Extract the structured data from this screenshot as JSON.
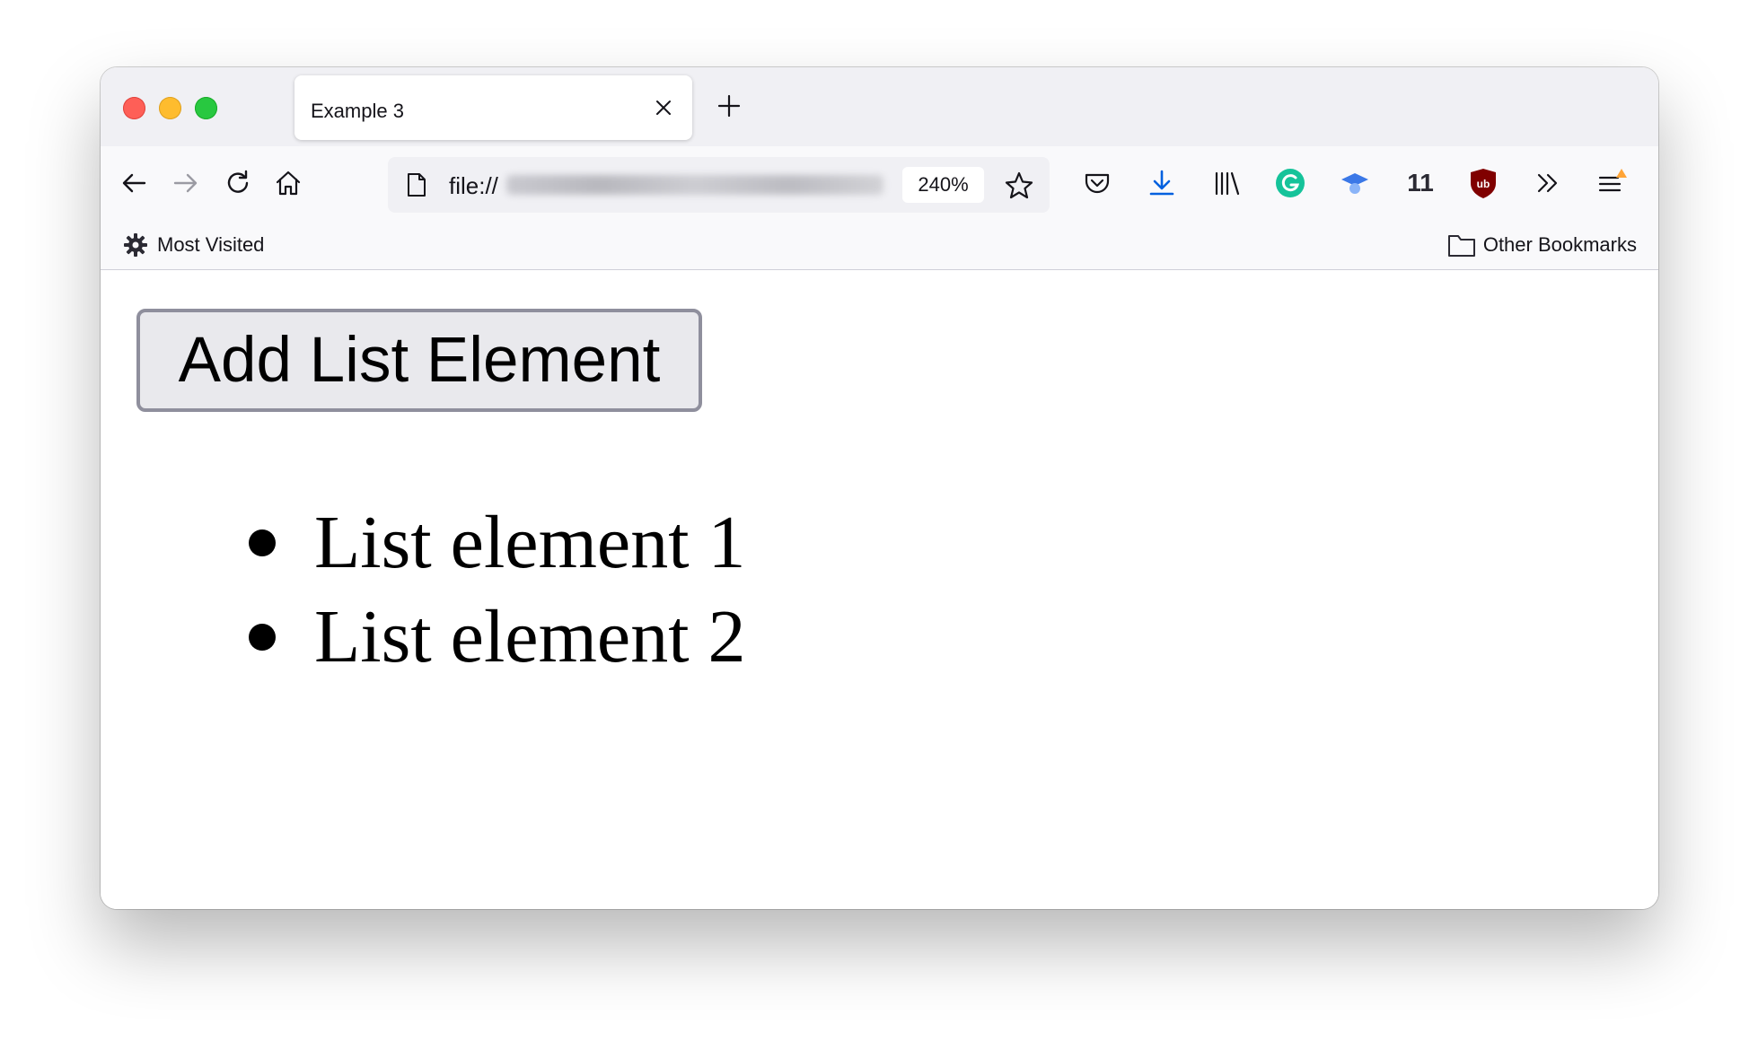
{
  "browser": {
    "tab": {
      "title": "Example 3"
    },
    "toolbar": {
      "url_scheme": "file://",
      "zoom_level": "240%",
      "extension_badge": "11"
    },
    "bookmarks_bar": {
      "most_visited": "Most Visited",
      "other_bookmarks": "Other Bookmarks"
    },
    "icons": [
      "back-icon",
      "forward-icon",
      "reload-icon",
      "home-icon",
      "page-icon",
      "star-icon",
      "pocket-icon",
      "download-icon",
      "library-icon",
      "grammarly-icon",
      "extension-icon",
      "ublock-icon",
      "overflow-icon",
      "menu-icon",
      "gear-icon",
      "folder-icon"
    ]
  },
  "page": {
    "button_label": "Add List Element",
    "list_items": [
      "List element 1",
      "List element 2"
    ]
  },
  "colors": {
    "traffic_red": "#fe5f57",
    "traffic_yellow": "#febc2e",
    "traffic_green": "#28c840",
    "download_blue": "#0060df",
    "grammarly_green": "#15c39a",
    "ublock_red": "#800000",
    "menu_badge_orange": "#ffa436"
  }
}
